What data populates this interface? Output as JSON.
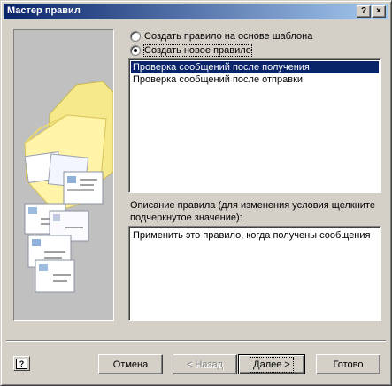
{
  "window": {
    "title": "Мастер правил",
    "help_glyph": "?",
    "close_glyph": "×"
  },
  "options": {
    "from_template": "Создать правило на основе шаблона",
    "new_rule": "Создать новое правило",
    "selected": "new_rule"
  },
  "rule_list": {
    "items": [
      "Проверка сообщений после получения",
      "Проверка сообщений после отправки"
    ],
    "selected_index": 0
  },
  "description": {
    "label": "Описание правила (для изменения условия щелкните подчеркнутое значение):",
    "text": "Применить это правило, когда получены сообщения"
  },
  "buttons": {
    "cancel": "Отмена",
    "back": "< Назад",
    "next": "Далее >",
    "finish": "Готово",
    "help_glyph": "?"
  }
}
